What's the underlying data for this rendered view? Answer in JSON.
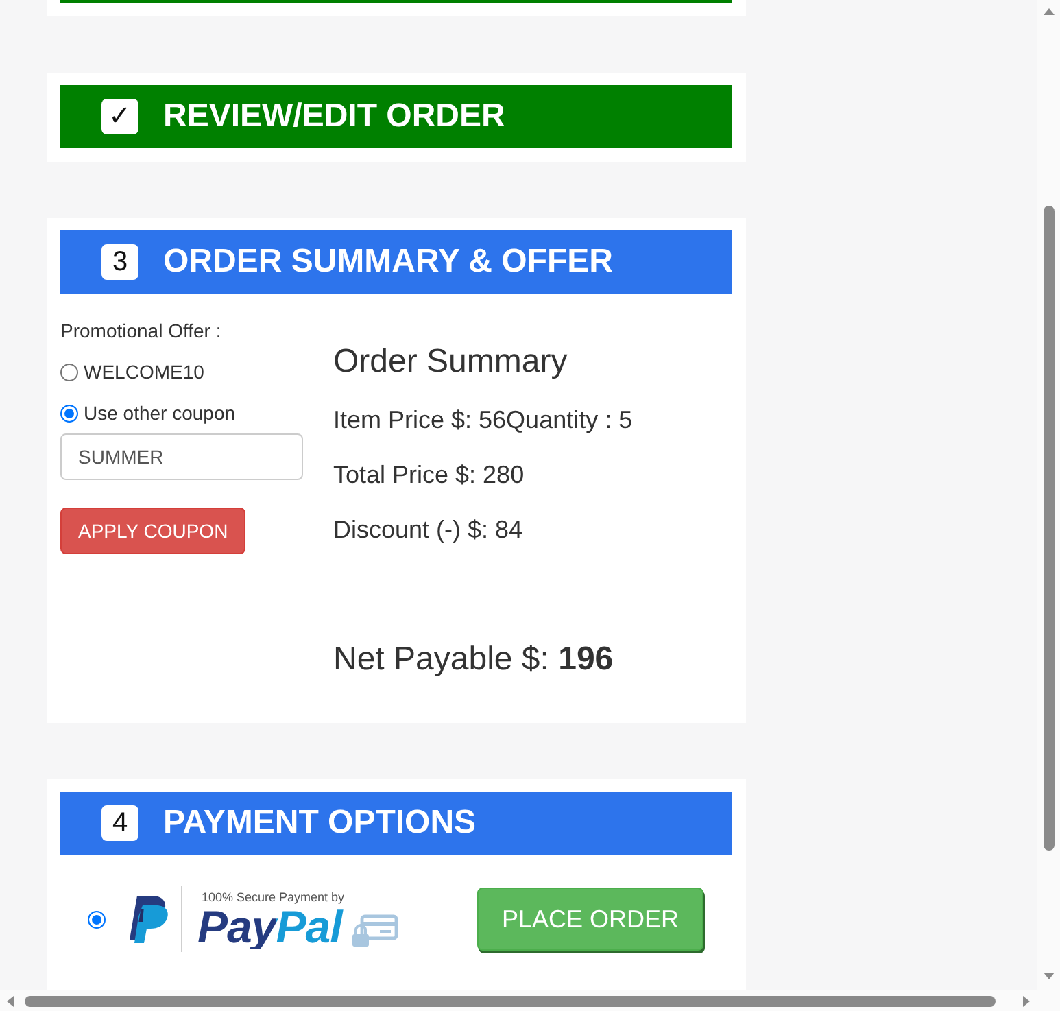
{
  "sections": [
    {
      "kind": "partial",
      "completed": true
    },
    {
      "kind": "collapsed",
      "completed": true,
      "badge": "✓",
      "title": "REVIEW/EDIT ORDER"
    },
    {
      "kind": "summary",
      "completed": false,
      "badge": "3",
      "title": "ORDER SUMMARY & OFFER",
      "offer": {
        "label": "Promotional Offer :",
        "options": [
          {
            "label": "WELCOME10",
            "selected": false
          },
          {
            "label": "Use other coupon",
            "selected": true
          }
        ],
        "coupon": {
          "value": "SUMMER"
        },
        "button": "APPLY COUPON"
      },
      "summary": {
        "title": "Order Summary",
        "lines": [
          "Item Price $: 56Quantity : 5",
          "Total Price $: 280",
          "Discount (-) $: 84"
        ],
        "net": "Net Payable $: **196**"
      }
    },
    {
      "kind": "payment",
      "completed": false,
      "badge": "4",
      "title": "PAYMENT OPTIONS",
      "methods": [
        {
          "selected": true,
          "caption": "100% Secure Payment by",
          "brand": "PayPal"
        }
      ],
      "button": "PLACE ORDER"
    }
  ]
}
